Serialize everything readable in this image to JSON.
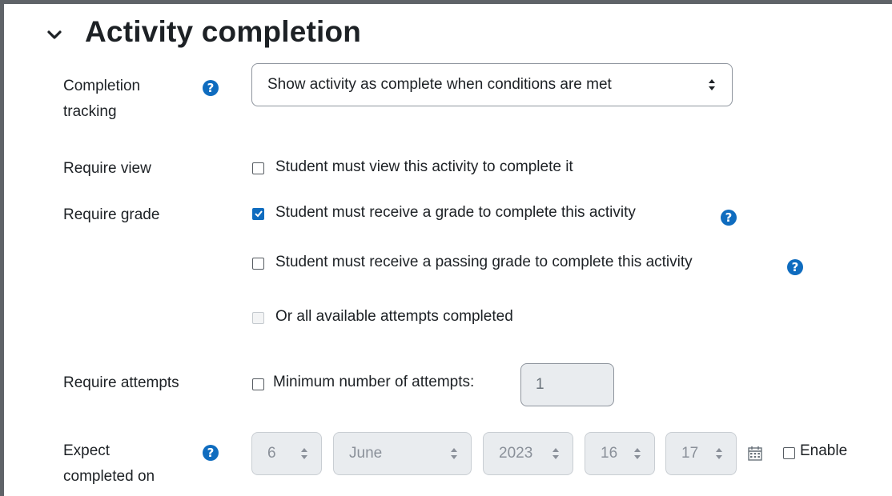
{
  "section": {
    "title": "Activity completion",
    "expanded": true
  },
  "completion_tracking": {
    "label_line1": "Completion",
    "label_line2": "tracking",
    "selected": "Show activity as complete when conditions are met"
  },
  "require_view": {
    "label": "Require view",
    "option": "Student must view this activity to complete it",
    "checked": false
  },
  "require_grade": {
    "label": "Require grade",
    "options": [
      {
        "text": "Student must receive a grade to complete this activity",
        "checked": true
      },
      {
        "text": "Student must receive a passing grade to complete this activity",
        "checked": false
      },
      {
        "text": "Or all available attempts completed",
        "checked": false,
        "disabled": true
      }
    ]
  },
  "require_attempts": {
    "label": "Require attempts",
    "option": "Minimum number of attempts:",
    "value": "1",
    "checked": false
  },
  "expect_completed": {
    "label_line1": "Expect",
    "label_line2": "completed on",
    "day": "6",
    "month": "June",
    "year": "2023",
    "hour": "16",
    "minute": "17",
    "enable_label": "Enable",
    "enabled": false
  },
  "icons": {
    "collapse": "chevron-down-icon",
    "help": "question-circle-icon",
    "calendar": "calendar-icon",
    "select": "sort-arrows-icon"
  },
  "colors": {
    "accent": "#0f6cbf",
    "text": "#1d2125",
    "disabled_bg": "#e9ecef"
  }
}
